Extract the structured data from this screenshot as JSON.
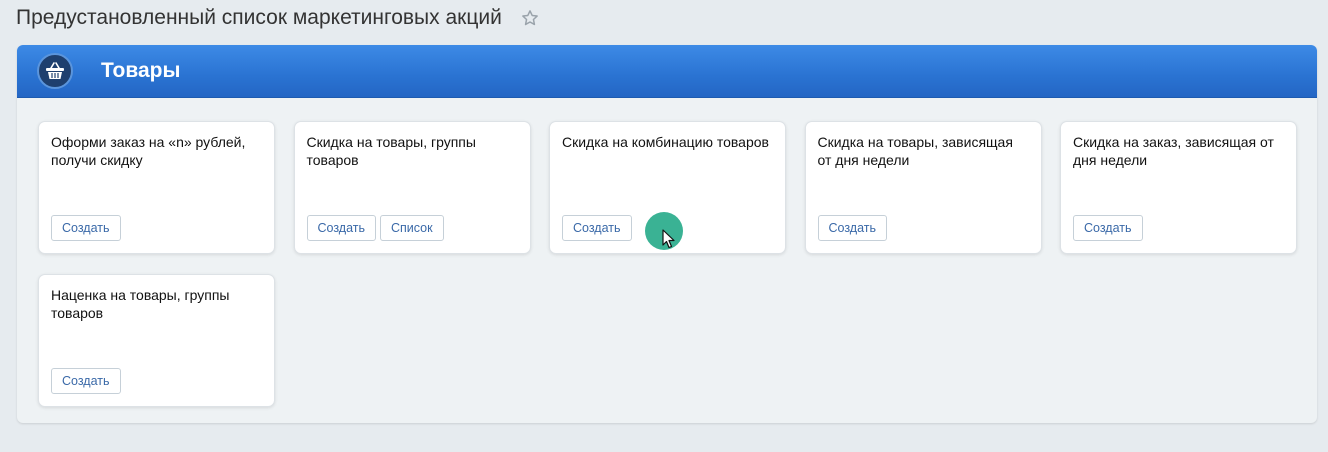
{
  "page": {
    "title": "Предустановленный список маркетинговых акций",
    "favorite_icon": "star-outline-icon"
  },
  "panel": {
    "title": "Товары",
    "icon": "basket-icon",
    "header_color": "#2a73d2"
  },
  "cards": [
    {
      "title": "Оформи заказ на «n» рублей, получи скидку",
      "buttons": [
        "Создать"
      ]
    },
    {
      "title": "Скидка на товары, группы товаров",
      "buttons": [
        "Создать",
        "Список"
      ]
    },
    {
      "title": "Скидка на комбинацию товаров",
      "buttons": [
        "Создать"
      ]
    },
    {
      "title": "Скидка на товары, зависящая от дня недели",
      "buttons": [
        "Создать"
      ]
    },
    {
      "title": "Скидка на заказ, зависящая от дня недели",
      "buttons": [
        "Создать"
      ]
    },
    {
      "title": "Наценка на товары, группы товаров",
      "buttons": [
        "Создать"
      ]
    }
  ],
  "colors": {
    "button_text": "#3a69a8",
    "click_highlight": "#2fae8e"
  }
}
